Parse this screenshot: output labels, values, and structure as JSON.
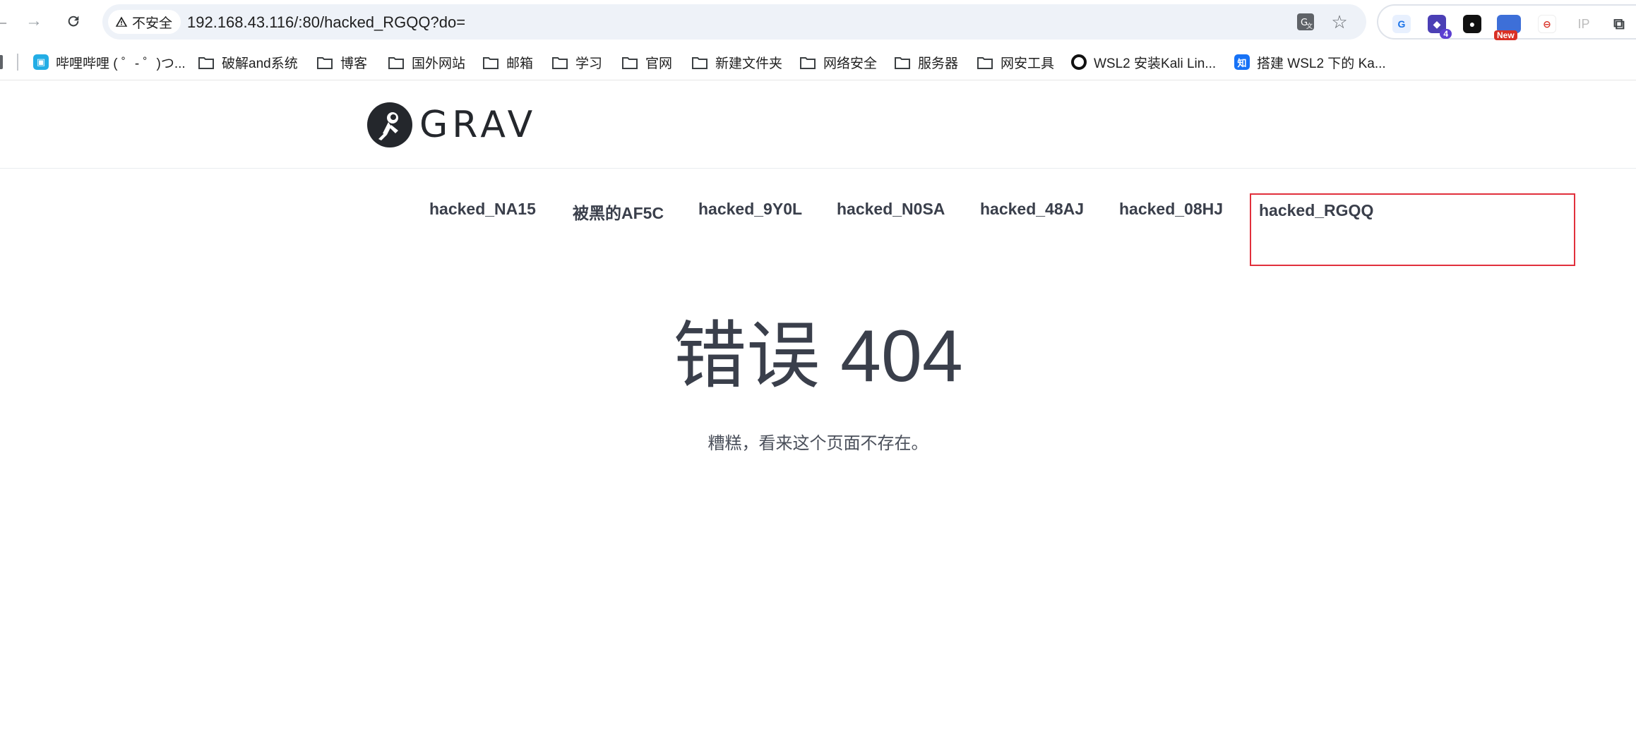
{
  "browser": {
    "security_label": "不安全",
    "url": "192.168.43.116/:80/hacked_RGQQ?do=",
    "extensions": {
      "badge_count": "4",
      "new_badge": "New",
      "ip_label": "IP"
    }
  },
  "bookmarks": [
    {
      "label": "哔哩哔哩 ( ゜- ゜)つ...",
      "icon": "bilibili-icon"
    },
    {
      "label": "破解and系统",
      "icon": "folder-icon"
    },
    {
      "label": "博客",
      "icon": "folder-icon"
    },
    {
      "label": "国外网站",
      "icon": "folder-icon"
    },
    {
      "label": "邮箱",
      "icon": "folder-icon"
    },
    {
      "label": "学习",
      "icon": "folder-icon"
    },
    {
      "label": "官网",
      "icon": "folder-icon"
    },
    {
      "label": "新建文件夹",
      "icon": "folder-icon"
    },
    {
      "label": "网络安全",
      "icon": "folder-icon"
    },
    {
      "label": "服务器",
      "icon": "folder-icon"
    },
    {
      "label": "网安工具",
      "icon": "folder-icon"
    },
    {
      "label": "WSL2 安装Kali Lin...",
      "icon": "circle-icon"
    },
    {
      "label": "搭建 WSL2 下的 Ka...",
      "icon": "zhihu-icon",
      "icon_text": "知"
    }
  ],
  "site": {
    "logo_text": "GRAV",
    "nav": [
      {
        "label": "hacked_NA15"
      },
      {
        "label": "被黑的AF5C"
      },
      {
        "label": "hacked_9Y0L"
      },
      {
        "label": "hacked_N0SA"
      },
      {
        "label": "hacked_48AJ"
      },
      {
        "label": "hacked_08HJ"
      },
      {
        "label": "hacked_RGQQ"
      }
    ],
    "error_title": "错误 404",
    "error_message": "糟糕，看来这个页面不存在。"
  },
  "colors": {
    "text": "#3a3f4b",
    "highlight_border": "#e1303c",
    "omnibox_bg": "#eef2f8"
  }
}
